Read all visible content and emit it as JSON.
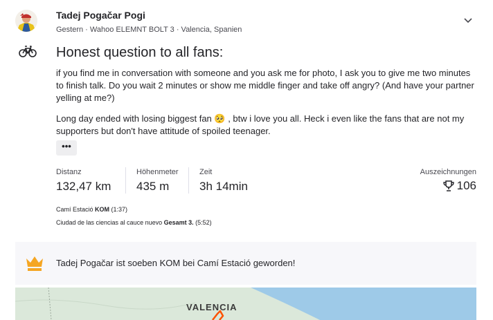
{
  "activity": {
    "athlete_name": "Tadej Pogačar Pogi",
    "meta": "Gestern · Wahoo ELEMNT BOLT 3 · Valencia, Spanien",
    "sport_icon": "bicycle-icon",
    "title": "Honest question to all fans:",
    "description_p1": "if you find me in conversation with someone and you ask me for photo, I ask you to give me two minutes to finish talk. Do you wait 2 minutes or show me middle finger and take off angry? (And have your partner yelling at me?)",
    "description_p2_before_emoji": "Long day ended with losing biggest fan ",
    "description_p2_emoji": "🥺",
    "description_p2_after_emoji": " , btw i love you all. Heck i even like the fans that are not my supporters but don't have attitude of spoiled teenager.",
    "more_label": "•••"
  },
  "stats": {
    "distance_label": "Distanz",
    "distance_value": "132,47 km",
    "elevation_label": "Höhenmeter",
    "elevation_value": "435 m",
    "time_label": "Zeit",
    "time_value": "3h 14min",
    "achievements_label": "Auszeichnungen",
    "achievements_icon": "trophy-icon",
    "achievements_value": "106"
  },
  "segments": [
    {
      "name": "Camí Estació ",
      "badge": "KOM",
      "time": " (1:37)"
    },
    {
      "name": "Ciudad de las ciencias al cauce nuevo ",
      "badge": "Gesamt 3.",
      "time": " (5:52)"
    }
  ],
  "kom_card": {
    "icon": "crown-icon",
    "text": "Tadej Pogačar ist soeben KOM bei Camí Estació geworden!"
  },
  "map": {
    "city_label": "VALENCIA",
    "route_color": "#fc5200",
    "land_color": "#dbe8da",
    "sea_color": "#9ecae8"
  },
  "colors": {
    "accent": "#fc5200",
    "crown": "#f5a623"
  }
}
